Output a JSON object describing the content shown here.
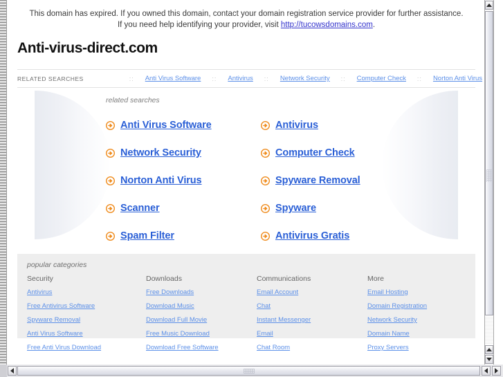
{
  "notice": {
    "text_before": "This domain has expired. If you owned this domain, contact your domain registration service provider for further assistance. If you need help identifying your provider, visit ",
    "link_text": "http://tucowsdomains.com",
    "text_after": "."
  },
  "domain_title": "Anti-virus-direct.com",
  "related_bar": {
    "label": "RELATED SEARCHES",
    "separator": "::",
    "links": [
      "Anti Virus Software",
      "Antivirus",
      "Network Security",
      "Computer Check",
      "Norton Anti Virus"
    ]
  },
  "hero": {
    "label": "related searches",
    "bullet_icon": "arrow-circle-right-icon",
    "bullet_color": "#ef8c1e",
    "link_color": "#2a5fd6",
    "links": [
      "Anti Virus Software",
      "Antivirus",
      "Network Security",
      "Computer Check",
      "Norton Anti Virus",
      "Spyware Removal",
      "Scanner",
      "Spyware",
      "Spam Filter",
      "Antivirus Gratis"
    ]
  },
  "categories": {
    "label": "popular categories",
    "columns": [
      {
        "heading": "Security",
        "links": [
          "Antivirus",
          "Free Antivirus Software",
          "Spyware Removal",
          "Anti Virus Software",
          "Free Anti Virus Download"
        ]
      },
      {
        "heading": "Downloads",
        "links": [
          "Free Downloads",
          "Download Music",
          "Download Full Movie",
          "Free Music Download",
          "Download Free Software"
        ]
      },
      {
        "heading": "Communications",
        "links": [
          "Email Account",
          "Chat",
          "Instant Messenger",
          "Email",
          "Chat Room"
        ]
      },
      {
        "heading": "More",
        "links": [
          "Email Hosting",
          "Domain Registration",
          "Network Security",
          "Domain Name",
          "Proxy Servers"
        ]
      }
    ]
  },
  "scrollbars": {
    "vertical_up_icon": "triangle-up-icon",
    "vertical_down_icon": "triangle-down-icon",
    "horizontal_left_icon": "triangle-left-icon",
    "horizontal_right_icon": "triangle-right-icon"
  }
}
